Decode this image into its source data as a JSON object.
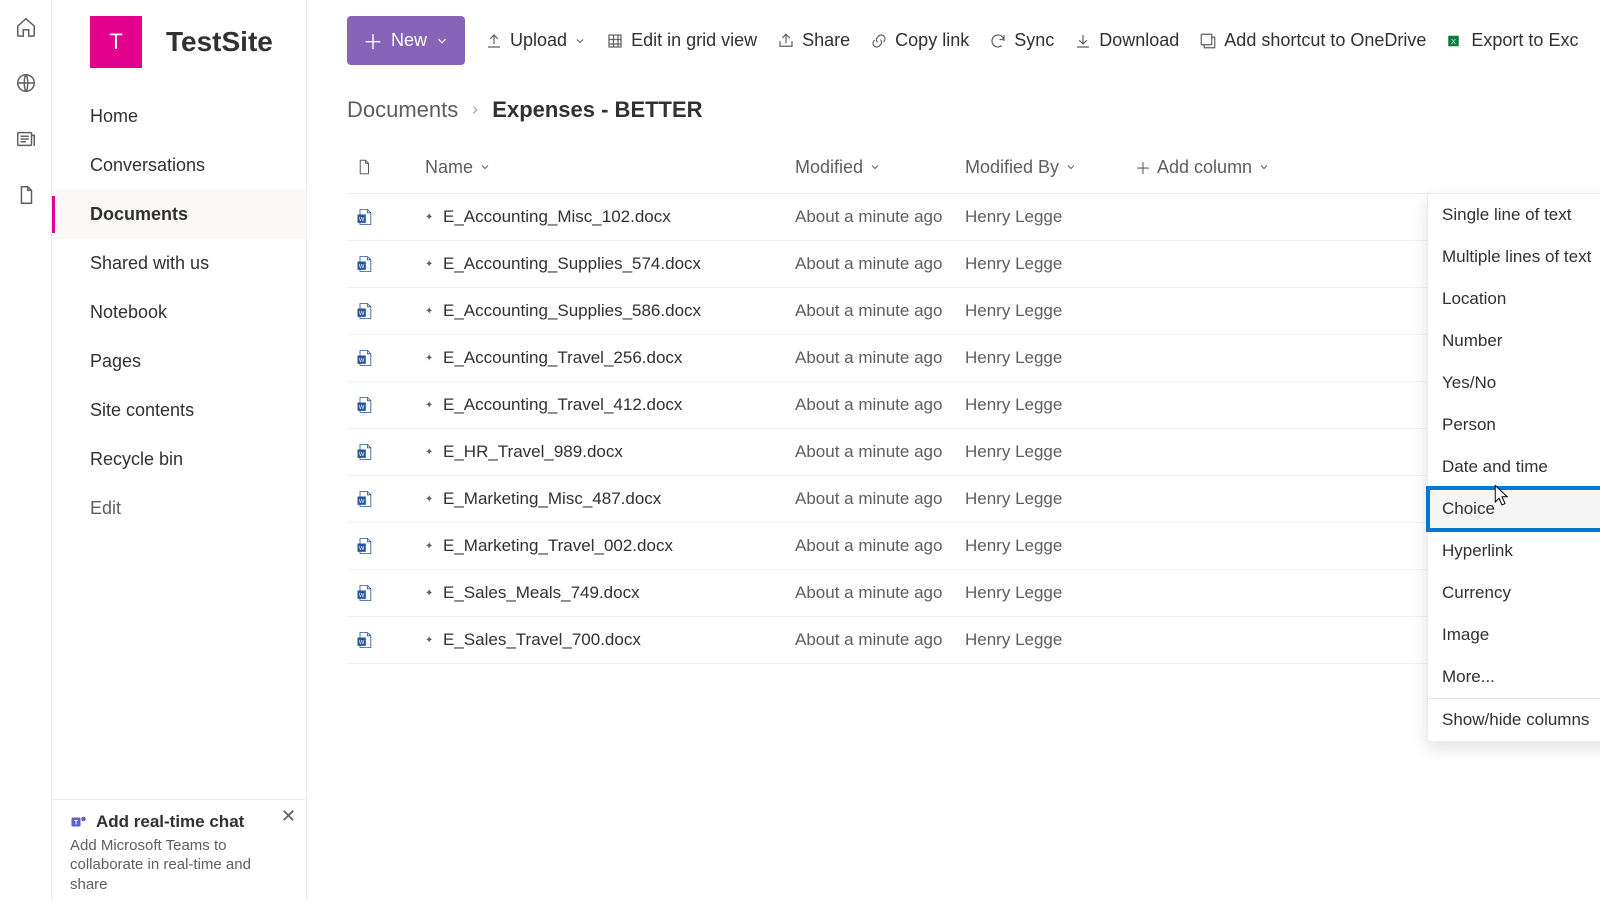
{
  "site": {
    "tile_letter": "T",
    "title": "TestSite"
  },
  "nav": {
    "items": [
      {
        "label": "Home"
      },
      {
        "label": "Conversations"
      },
      {
        "label": "Documents",
        "active": true
      },
      {
        "label": "Shared with us"
      },
      {
        "label": "Notebook"
      },
      {
        "label": "Pages"
      },
      {
        "label": "Site contents"
      },
      {
        "label": "Recycle bin"
      }
    ],
    "edit_label": "Edit"
  },
  "chat_promo": {
    "title": "Add real-time chat",
    "body": "Add Microsoft Teams to collaborate in real-time and share"
  },
  "toolbar": {
    "new": "New",
    "upload": "Upload",
    "edit_grid": "Edit in grid view",
    "share": "Share",
    "copy_link": "Copy link",
    "sync": "Sync",
    "download": "Download",
    "add_shortcut": "Add shortcut to OneDrive",
    "export_excel": "Export to Exc"
  },
  "breadcrumb": {
    "parent": "Documents",
    "current": "Expenses - BETTER"
  },
  "columns": {
    "name": "Name",
    "modified": "Modified",
    "modified_by": "Modified By",
    "add_column": "Add column"
  },
  "rows": [
    {
      "name": "E_Accounting_Misc_102.docx",
      "modified": "About a minute ago",
      "modified_by": "Henry Legge"
    },
    {
      "name": "E_Accounting_Supplies_574.docx",
      "modified": "About a minute ago",
      "modified_by": "Henry Legge"
    },
    {
      "name": "E_Accounting_Supplies_586.docx",
      "modified": "About a minute ago",
      "modified_by": "Henry Legge"
    },
    {
      "name": "E_Accounting_Travel_256.docx",
      "modified": "About a minute ago",
      "modified_by": "Henry Legge"
    },
    {
      "name": "E_Accounting_Travel_412.docx",
      "modified": "About a minute ago",
      "modified_by": "Henry Legge"
    },
    {
      "name": "E_HR_Travel_989.docx",
      "modified": "About a minute ago",
      "modified_by": "Henry Legge"
    },
    {
      "name": "E_Marketing_Misc_487.docx",
      "modified": "About a minute ago",
      "modified_by": "Henry Legge"
    },
    {
      "name": "E_Marketing_Travel_002.docx",
      "modified": "About a minute ago",
      "modified_by": "Henry Legge"
    },
    {
      "name": "E_Sales_Meals_749.docx",
      "modified": "About a minute ago",
      "modified_by": "Henry Legge"
    },
    {
      "name": "E_Sales_Travel_700.docx",
      "modified": "About a minute ago",
      "modified_by": "Henry Legge"
    }
  ],
  "add_column_menu": [
    {
      "label": "Single line of text"
    },
    {
      "label": "Multiple lines of text"
    },
    {
      "label": "Location"
    },
    {
      "label": "Number"
    },
    {
      "label": "Yes/No"
    },
    {
      "label": "Person"
    },
    {
      "label": "Date and time"
    },
    {
      "label": "Choice",
      "highlight": true
    },
    {
      "label": "Hyperlink"
    },
    {
      "label": "Currency"
    },
    {
      "label": "Image"
    },
    {
      "label": "More..."
    },
    {
      "label": "Show/hide columns",
      "divider_before": true
    }
  ]
}
